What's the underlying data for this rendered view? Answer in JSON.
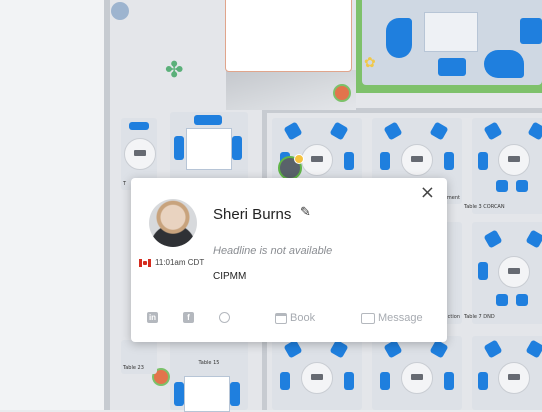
{
  "profile": {
    "name": "Sheri Burns",
    "headline": "Headline is not available",
    "local_time": "11:01am CDT",
    "credential": "CIPMM",
    "close_glyph": "×",
    "actions": {
      "book": "Book",
      "message": "Message"
    },
    "social_icons": [
      "linkedin-icon",
      "facebook-icon",
      "globe-icon"
    ]
  },
  "floor_labels": {
    "table_3": "Table 3 CORCAN",
    "table_7": "Table 7 DND",
    "table_15": "Table 15",
    "table_23": "Table 23",
    "partial_ment": "ment",
    "partial_ction": "ction",
    "partial_t1": "T",
    "partial_t2": "T"
  },
  "colors": {
    "chair": "#1f7fde",
    "lounge": "#7ec16b",
    "accent_pin": "#e2744c"
  }
}
